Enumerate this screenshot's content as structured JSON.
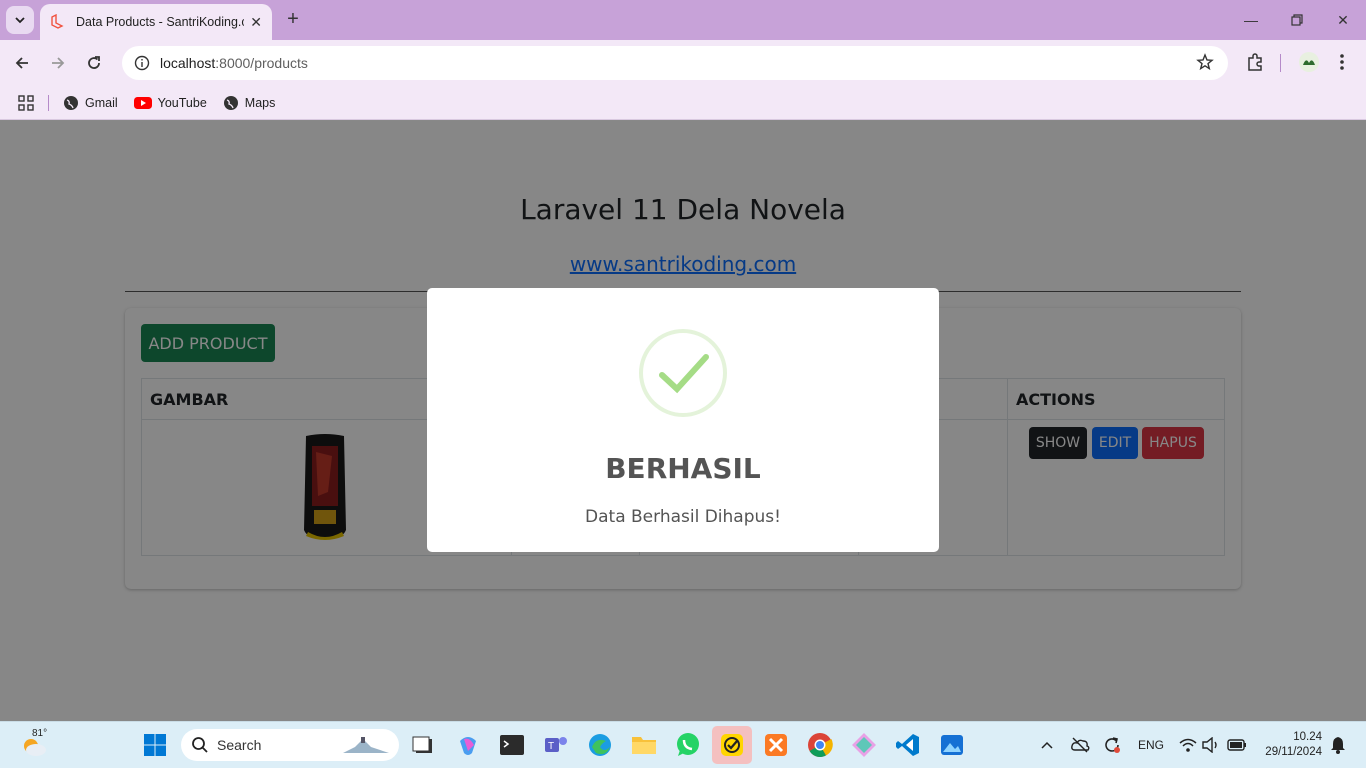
{
  "browser": {
    "tab_title": "Data Products - SantriKoding.com",
    "url_host": "localhost",
    "url_path": ":8000/products",
    "bookmarks": [
      "Gmail",
      "YouTube",
      "Maps"
    ]
  },
  "page": {
    "heading": "Laravel 11 Dela Novela",
    "site_link": "www.santrikoding.com",
    "add_button": "ADD PRODUCT",
    "table": {
      "col_image": "GAMBAR",
      "col_actions": "ACTIONS"
    },
    "actions": {
      "show": "SHOW",
      "edit": "EDIT",
      "delete": "HAPUS"
    }
  },
  "modal": {
    "title": "BERHASIL",
    "text": "Data Berhasil Dihapus!"
  },
  "taskbar": {
    "weather": "81°",
    "search_label": "Search",
    "lang": "ENG",
    "time": "10.24",
    "date": "29/11/2024"
  },
  "colors": {
    "tabbar": "#c7a2d8",
    "toolbar": "#f3e8f7",
    "success_green": "#198754",
    "show_btn": "#212529",
    "edit_btn": "#0d6efd",
    "delete_btn": "#dc3545",
    "check_green": "#a5dc86"
  }
}
